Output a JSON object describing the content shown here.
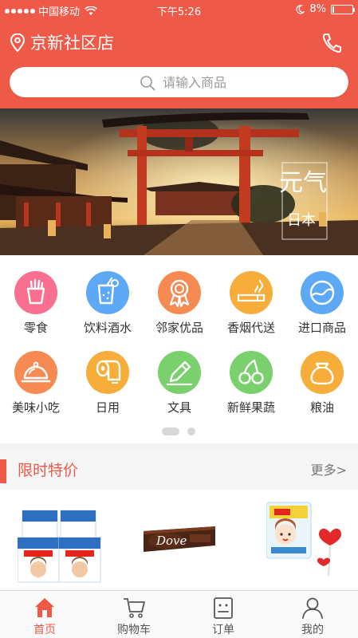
{
  "status_bar": {
    "carrier": "中国移动",
    "time": "下午5:26",
    "battery": "8%",
    "battery_level": 0.08
  },
  "header": {
    "store_name": "京新社区店",
    "icons": {
      "location": "location-pin-icon",
      "phone": "phone-icon"
    }
  },
  "search": {
    "placeholder": "请输入商品"
  },
  "banner": {
    "title": "元气",
    "subtitle": "日本",
    "slide_count": 3,
    "active_slide": 0
  },
  "categories": [
    {
      "label": "零食",
      "icon": "french-fries-icon",
      "color": "#f86f8f"
    },
    {
      "label": "饮料酒水",
      "icon": "drink-cup-icon",
      "color": "#5ea9f5"
    },
    {
      "label": "邻家优品",
      "icon": "award-medal-icon",
      "color": "#f58a52"
    },
    {
      "label": "香烟代送",
      "icon": "cigarette-icon",
      "color": "#f7ad39"
    },
    {
      "label": "进口商品",
      "icon": "globe-icon",
      "color": "#5ea9f5"
    },
    {
      "label": "美味小吃",
      "icon": "food-cloche-icon",
      "color": "#f58a52"
    },
    {
      "label": "日用",
      "icon": "toilet-paper-icon",
      "color": "#f7ad39"
    },
    {
      "label": "文具",
      "icon": "pencil-icon",
      "color": "#79d06c"
    },
    {
      "label": "新鲜果蔬",
      "icon": "cherry-icon",
      "color": "#79d06c"
    },
    {
      "label": "粮油",
      "icon": "grain-sack-icon",
      "color": "#f7ad39"
    }
  ],
  "category_pages": {
    "count": 2,
    "active": 0
  },
  "flash_sale": {
    "title": "限时特价",
    "more": "更多>",
    "accent": "#ef5948",
    "products": [
      {
        "name": "kinder-chocolate",
        "logo_text": "Kinder Chocolate"
      },
      {
        "name": "dove-chocolate",
        "logo_text": "Dove"
      },
      {
        "name": "peko-lollipop",
        "logo_text": ""
      }
    ]
  },
  "tabbar": {
    "tabs": [
      {
        "label": "首页",
        "icon": "home-icon",
        "active": true
      },
      {
        "label": "购物车",
        "icon": "cart-icon",
        "active": false
      },
      {
        "label": "订单",
        "icon": "order-icon",
        "active": false
      },
      {
        "label": "我的",
        "icon": "user-icon",
        "active": false
      }
    ]
  },
  "colors": {
    "brand": "#ef5948",
    "background": "#ffffff",
    "section_bg": "#f6f6f6"
  }
}
